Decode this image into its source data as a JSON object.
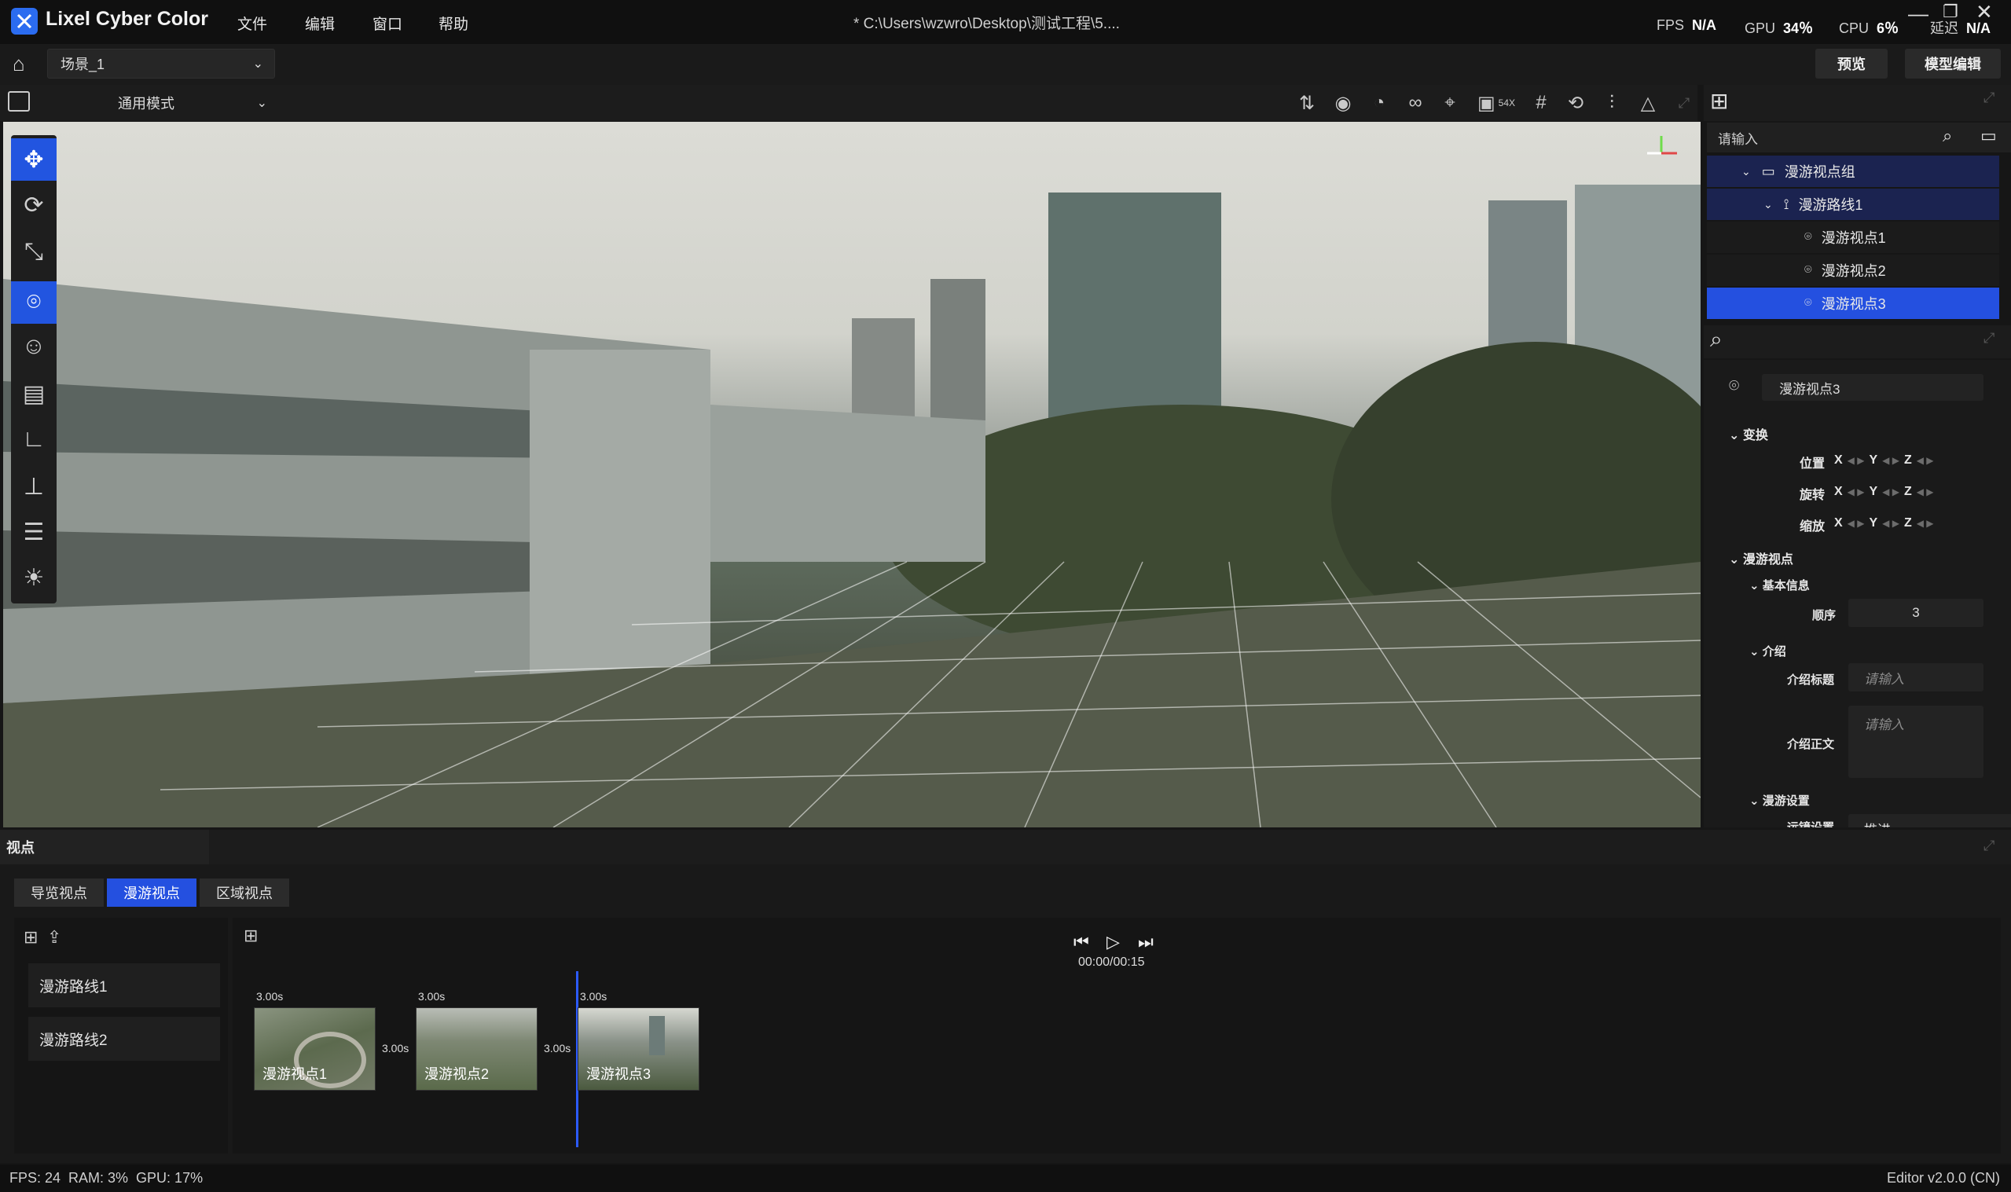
{
  "app": {
    "title": "Lixel Cyber Color",
    "menu": [
      "文件",
      "编辑",
      "窗口",
      "帮助"
    ],
    "file_path": "* C:\\Users\\wzwro\\Desktop\\测试工程\\5....",
    "stats": {
      "fps_label": "FPS",
      "fps_value": "N/A",
      "gpu_label": "GPU",
      "gpu_value": "34％",
      "cpu_label": "CPU",
      "cpu_value": "6％",
      "latency_label": "延迟",
      "latency_value": "N/A"
    }
  },
  "toolbar": {
    "scene": "场景_1",
    "preview_label": "预览",
    "model_edit_label": "模型编辑",
    "mode": "通用模式",
    "speed_badge": "54X"
  },
  "left_tools": [
    {
      "icon": "move-icon",
      "active": true
    },
    {
      "icon": "rotate-icon",
      "active": false
    },
    {
      "icon": "scale-icon",
      "active": false
    },
    {
      "icon": "viewpoint-icon",
      "active": true
    },
    {
      "icon": "character-icon",
      "active": false
    },
    {
      "icon": "annotation-icon",
      "active": false
    },
    {
      "icon": "measure-icon",
      "active": false
    },
    {
      "icon": "section-icon",
      "active": false
    },
    {
      "icon": "list-icon",
      "active": false
    },
    {
      "icon": "light-icon",
      "active": false
    }
  ],
  "scene_tree": {
    "search_placeholder": "请输入",
    "items": [
      {
        "label": "漫游视点组",
        "level": 0
      },
      {
        "label": "漫游路线1",
        "level": 1
      },
      {
        "label": "漫游视点1",
        "level": 2
      },
      {
        "label": "漫游视点2",
        "level": 2
      },
      {
        "label": "漫游视点3",
        "level": 2,
        "selected": true
      }
    ]
  },
  "properties": {
    "name": "漫游视点3",
    "transform_label": "变换",
    "position_label": "位置",
    "rotation_label": "旋转",
    "scale_label": "缩放",
    "axes": [
      "X",
      "Y",
      "Z"
    ],
    "roam_section": "漫游视点",
    "basic_info": "基本信息",
    "order_label": "顺序",
    "order_value": "3",
    "intro_section": "介绍",
    "intro_title_label": "介绍标题",
    "intro_title_placeholder": "请输入",
    "intro_body_label": "介绍正文",
    "intro_body_placeholder": "请输入",
    "roam_settings": "漫游设置",
    "motion_label": "运镜设置",
    "motion_value": "推进"
  },
  "bottom": {
    "panel_title": "视点",
    "tabs": [
      "导览视点",
      "漫游视点",
      "区域视点"
    ],
    "active_tab": 1,
    "routes": [
      "漫游路线1",
      "漫游路线2"
    ],
    "time": "00:00/00:15",
    "keyframes": [
      {
        "label": "漫游视点1",
        "duration": "3.00s"
      },
      {
        "label": "漫游视点2",
        "duration": "3.00s"
      },
      {
        "label": "漫游视点3",
        "duration": "3.00s"
      }
    ],
    "transitions": [
      "3.00s",
      "3.00s"
    ]
  },
  "status": {
    "left": "FPS: 24  RAM: 3%  GPU: 17%",
    "right": "Editor v2.0.0 (CN)"
  },
  "colors": {
    "accent": "#2450e0",
    "tree_parent": "#1b2350"
  }
}
